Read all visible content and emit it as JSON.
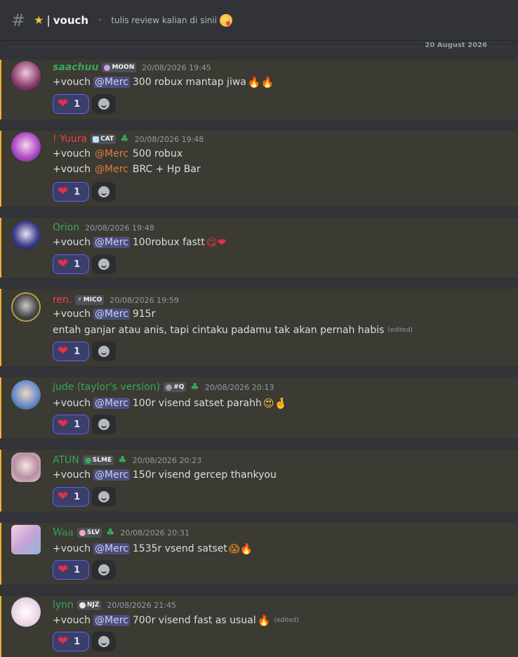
{
  "channel": {
    "name": "vouch",
    "topic": "tulis review kalian di sinii",
    "star_icon": "star-icon",
    "topic_emoji": "yum-face-icon"
  },
  "date_divider": "20 August 2026",
  "messages": [
    {
      "username": "saachuu",
      "name_color": "#3ba55d",
      "tag": "MOON",
      "timestamp": "20/08/2026 19:45",
      "lines": [
        {
          "prefix": "+vouch",
          "mention": "@Merc",
          "text": "300 robux mantap jiwa",
          "emoji": "🔥🔥"
        }
      ],
      "reaction_count": "1"
    },
    {
      "username": "! Yuura",
      "name_color": "#ed4245",
      "tag": "CAT",
      "timestamp": "20/08/2026 19:48",
      "lines": [
        {
          "prefix": "+vouch",
          "mention": "@Merc",
          "text": "500 robux",
          "emoji": ""
        },
        {
          "prefix": "+vouch",
          "mention": "@Merc",
          "text": "BRC + Hp Bar",
          "emoji": ""
        }
      ],
      "reaction_count": "1"
    },
    {
      "username": "Orion",
      "name_color": "#3ba55d",
      "timestamp": "20/08/2026 19:48",
      "lines": [
        {
          "prefix": "+vouch",
          "mention": "@Merc",
          "text": "100robux fastt",
          "emoji": "😋❤"
        }
      ],
      "reaction_count": "1"
    },
    {
      "username": "ren.",
      "name_color": "#ed4245",
      "tag": "MICO",
      "timestamp": "20/08/2026 19:59",
      "lines": [
        {
          "prefix": "+vouch",
          "mention": "@Merc",
          "text": "915r",
          "emoji": ""
        },
        {
          "prefix": "",
          "mention": "",
          "text": "entah ganjar atau anis, tapi cintaku padamu tak akan pernah habis",
          "edited": "(edited)"
        }
      ],
      "reaction_count": "1"
    },
    {
      "username": "jude  (taylor's version)",
      "name_color": "#3ba55d",
      "tag": "#Q",
      "timestamp": "20/08/2026 20:13",
      "lines": [
        {
          "prefix": "+vouch",
          "mention": "@Merc",
          "text": "100r visend satset parahh",
          "emoji": "😍🤞"
        }
      ],
      "reaction_count": "1"
    },
    {
      "username": "ATUN",
      "name_color": "#3ba55d",
      "tag": "SLME",
      "timestamp": "20/08/2026 20:23",
      "lines": [
        {
          "prefix": "+vouch",
          "mention": "@Merc",
          "text": "150r visend gercep thankyou",
          "emoji": ""
        }
      ],
      "reaction_count": "1"
    },
    {
      "username": "Waa",
      "name_color": "#3ba55d",
      "tag": "SLV",
      "timestamp": "20/08/2026 20:31",
      "lines": [
        {
          "prefix": "+vouch",
          "mention": "@Merc",
          "text": "1535r vsend satset",
          "emoji": "😱🔥"
        }
      ],
      "reaction_count": "1"
    },
    {
      "username": "lynn",
      "name_color": "#3ba55d",
      "tag": "NJZ",
      "timestamp": "20/08/2026 21:45",
      "lines": [
        {
          "prefix": "+vouch",
          "mention": "@Merc",
          "text": "700r visend fast as usual",
          "emoji": "🔥",
          "edited": "(edited)"
        }
      ],
      "reaction_count": "1"
    }
  ]
}
